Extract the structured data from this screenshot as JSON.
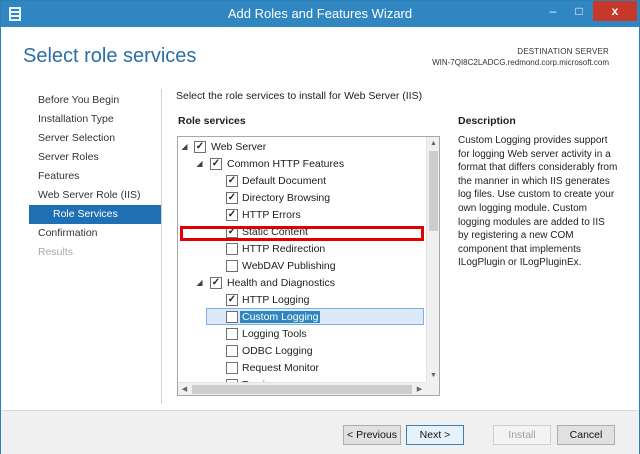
{
  "window": {
    "title": "Add Roles and Features Wizard",
    "close_glyph": "x",
    "minimize_glyph": "–",
    "maximize_glyph": "□"
  },
  "header": {
    "page_title": "Select role services",
    "destination_label": "DESTINATION SERVER",
    "destination_server": "WIN-7QI8C2LADCG.redmond.corp.microsoft.com"
  },
  "nav": {
    "items": [
      {
        "label": "Before You Begin",
        "state": "normal"
      },
      {
        "label": "Installation Type",
        "state": "normal"
      },
      {
        "label": "Server Selection",
        "state": "normal"
      },
      {
        "label": "Server Roles",
        "state": "normal"
      },
      {
        "label": "Features",
        "state": "normal"
      },
      {
        "label": "Web Server Role (IIS)",
        "state": "normal"
      },
      {
        "label": "Role Services",
        "state": "active"
      },
      {
        "label": "Confirmation",
        "state": "normal"
      },
      {
        "label": "Results",
        "state": "disabled"
      }
    ]
  },
  "main": {
    "instruction": "Select the role services to install for Web Server (IIS)",
    "role_services_heading": "Role services",
    "description_heading": "Description",
    "description_text": "Custom Logging provides support for logging Web server activity in a format that differs considerably from the manner in which IIS generates log files. Use custom to create your own logging module. Custom logging modules are added to IIS by registering a new COM component that implements ILogPlugin or ILogPluginEx."
  },
  "tree": {
    "expand_glyph": "◢",
    "check_glyph": "✓",
    "items": [
      {
        "label": "Web Server",
        "level": 0,
        "expander": true,
        "checked": true
      },
      {
        "label": "Common HTTP Features",
        "level": 1,
        "expander": true,
        "checked": true
      },
      {
        "label": "Default Document",
        "level": 2,
        "expander": false,
        "checked": true
      },
      {
        "label": "Directory Browsing",
        "level": 2,
        "expander": false,
        "checked": true
      },
      {
        "label": "HTTP Errors",
        "level": 2,
        "expander": false,
        "checked": true
      },
      {
        "label": "Static Content",
        "level": 2,
        "expander": false,
        "checked": true
      },
      {
        "label": "HTTP Redirection",
        "level": 2,
        "expander": false,
        "checked": false
      },
      {
        "label": "WebDAV Publishing",
        "level": 2,
        "expander": false,
        "checked": false
      },
      {
        "label": "Health and Diagnostics",
        "level": 1,
        "expander": true,
        "checked": true
      },
      {
        "label": "HTTP Logging",
        "level": 2,
        "expander": false,
        "checked": true
      },
      {
        "label": "Custom Logging",
        "level": 2,
        "expander": false,
        "checked": false,
        "selected": true
      },
      {
        "label": "Logging Tools",
        "level": 2,
        "expander": false,
        "checked": false
      },
      {
        "label": "ODBC Logging",
        "level": 2,
        "expander": false,
        "checked": false
      },
      {
        "label": "Request Monitor",
        "level": 2,
        "expander": false,
        "checked": false
      },
      {
        "label": "Tracing",
        "level": 2,
        "expander": false,
        "checked": false
      }
    ]
  },
  "scrollbars": {
    "up": "▲",
    "down": "▼",
    "left": "◀",
    "right": "▶"
  },
  "footer": {
    "previous_label": "< Previous",
    "next_label": "Next >",
    "install_label": "Install",
    "cancel_label": "Cancel"
  },
  "colors": {
    "title_bar": "#2f86c0",
    "accent": "#1e6fb4",
    "highlight_box": "#e00000"
  }
}
